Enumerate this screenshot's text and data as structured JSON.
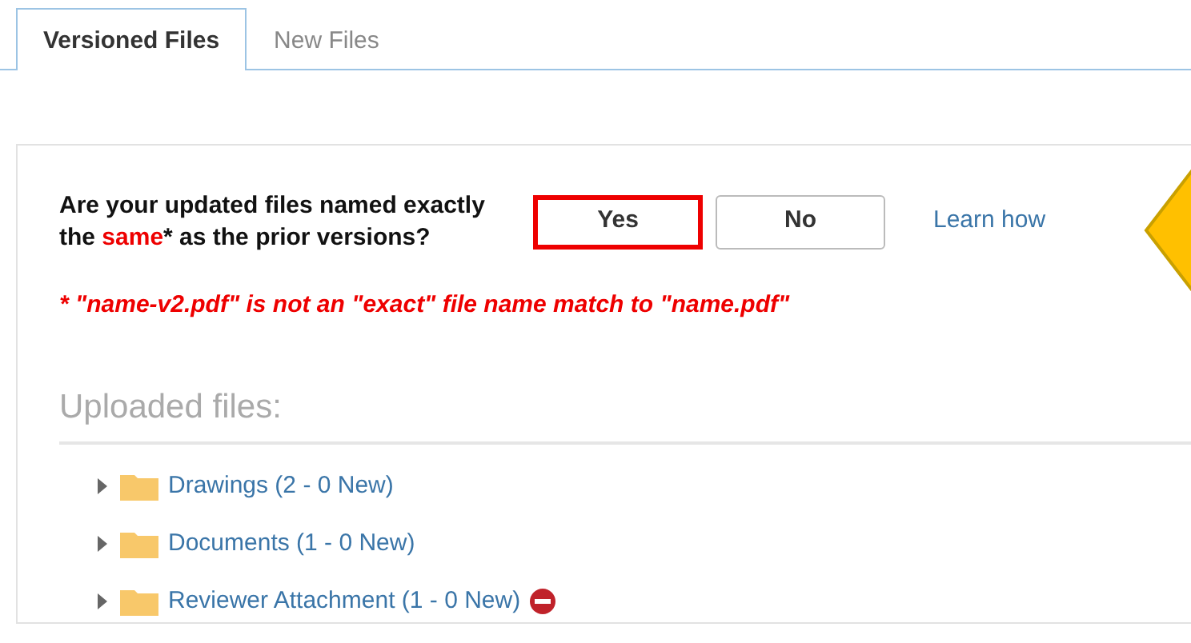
{
  "tabs": [
    {
      "label": "Versioned Files",
      "selected": true
    },
    {
      "label": "New Files",
      "selected": false
    }
  ],
  "question": {
    "text": "Are your updated files named exactly the **same*** as the prior versions?",
    "buttons": [
      {
        "label": "Yes",
        "highlighted": true
      },
      {
        "label": "No",
        "highlighted": false
      }
    ],
    "link": "Learn how",
    "note": "* \"name-v2.pdf\" is not an \"exact\" file name match to \"name.pdf\""
  },
  "uploaded": {
    "heading": "Uploaded files:",
    "folders": [
      {
        "label": "Drawings (2 - 0 New)",
        "expanded": false,
        "blocked": false
      },
      {
        "label": "Documents (1 - 0 New)",
        "expanded": false,
        "blocked": false
      },
      {
        "label": "Reviewer Attachment (1 - 0 New)",
        "expanded": false,
        "blocked": true
      }
    ]
  }
}
